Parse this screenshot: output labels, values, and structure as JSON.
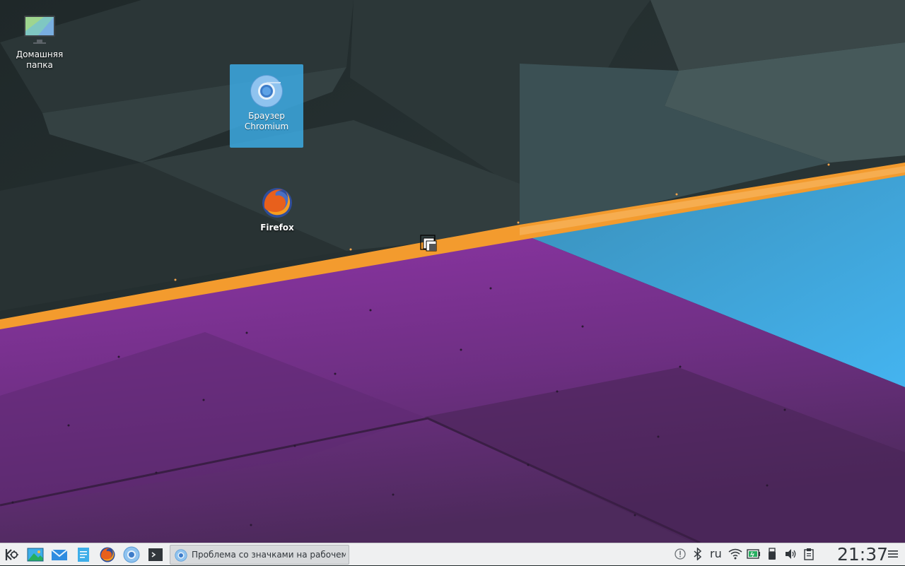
{
  "desktop": {
    "icons": [
      {
        "label": "Домашняя папка",
        "icon": "home-folder-icon"
      },
      {
        "label": "Браузер Chromium",
        "icon": "chromium-icon",
        "selected": true
      },
      {
        "label": "Firefox",
        "icon": "firefox-icon"
      }
    ]
  },
  "taskbar": {
    "launchers": [
      {
        "icon": "kde-application-launcher-icon"
      },
      {
        "icon": "image-viewer-icon"
      },
      {
        "icon": "mail-icon"
      },
      {
        "icon": "text-editor-icon"
      },
      {
        "icon": "firefox-icon"
      },
      {
        "icon": "chromium-icon"
      },
      {
        "icon": "terminal-icon"
      }
    ],
    "task": {
      "title": "Проблема со значками на рабочем",
      "icon": "chromium-icon"
    },
    "tray": {
      "notifications_icon": "notifications-icon",
      "bluetooth_icon": "bluetooth-icon",
      "keyboard_layout": "ru",
      "wifi_icon": "wifi-icon",
      "battery_icon": "battery-icon",
      "usb_icon": "usb-device-icon",
      "volume_icon": "volume-icon",
      "clipboard_icon": "clipboard-icon"
    },
    "clock": "21:37",
    "menu_icon": "panel-menu-icon"
  },
  "colors": {
    "selection": "#3daee9",
    "panel": "#eff0f1",
    "orange": "#f39b2e",
    "purple": "#7f2f8f",
    "blue": "#3daee9"
  }
}
